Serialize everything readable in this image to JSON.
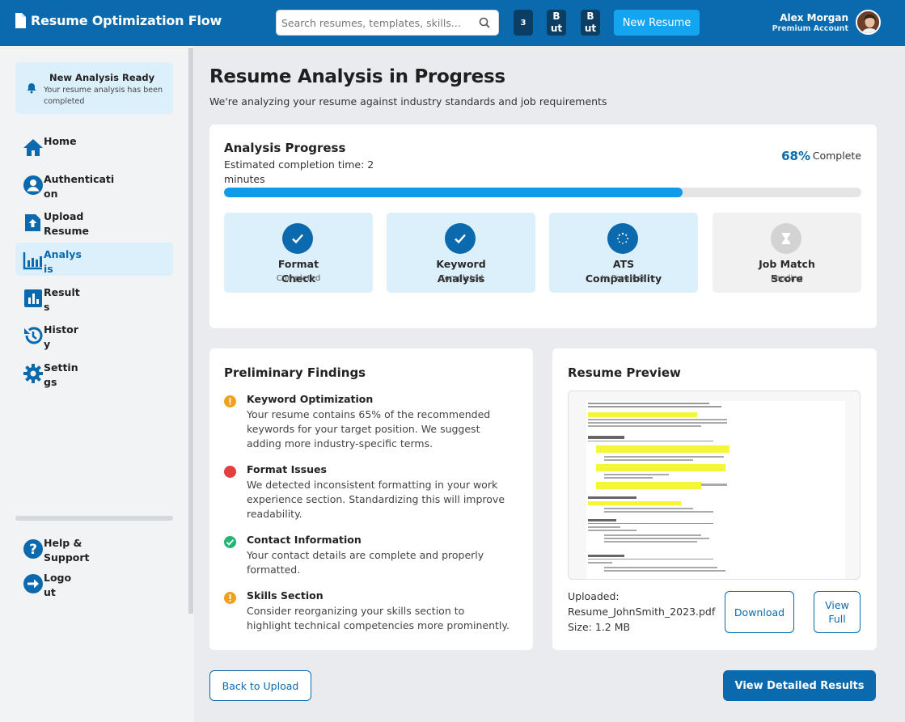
{
  "header": {
    "title": "Resume Optimization Flow",
    "search_placeholder": "Search resumes, templates, skills...",
    "badge_count": "3",
    "button_2": "B\nut",
    "button_3": "B\nut",
    "new_resume_label": "New Resume",
    "user_name": "Alex Morgan",
    "user_plan": "Premium Account",
    "accent_color": "#0a6aad"
  },
  "sidebar": {
    "notice": {
      "title": "New Analysis Ready",
      "text": "Your resume analysis has been completed"
    },
    "items": [
      {
        "label": "Home",
        "icon": "home-icon"
      },
      {
        "label": "Authentication",
        "icon": "user-icon"
      },
      {
        "label": "Upload Resume",
        "icon": "upload-icon"
      },
      {
        "label": "Analysis",
        "icon": "analysis-icon",
        "active": true
      },
      {
        "label": "Results",
        "icon": "results-icon"
      },
      {
        "label": "History",
        "icon": "history-icon"
      },
      {
        "label": "Settings",
        "icon": "gear-icon"
      }
    ],
    "bottom_items": [
      {
        "label": "Help & Support",
        "icon": "help-icon"
      },
      {
        "label": "Logout",
        "icon": "logout-icon"
      }
    ]
  },
  "main": {
    "title": "Resume Analysis in Progress",
    "subtitle": "We're analyzing your resume against industry standards and job requirements",
    "progress": {
      "title": "Analysis Progress",
      "estimate": "Estimated completion time: 2 minutes",
      "percent_label": "68%",
      "complete_label": "Complete",
      "fraction": 0.72,
      "steps": [
        {
          "name": "Format Check",
          "status": "Completed",
          "state": "done"
        },
        {
          "name": "Keyword Analysis",
          "status": "Completed",
          "state": "done"
        },
        {
          "name": "ATS Compatibility",
          "status": "In Progress",
          "state": "progress"
        },
        {
          "name": "Job Match Score",
          "status": "Pending",
          "state": "pending"
        }
      ]
    },
    "findings": {
      "title": "Preliminary Findings",
      "items": [
        {
          "title": "Keyword Optimization",
          "text": "Your resume contains 65% of the recommended keywords for your target position. We suggest adding more industry-specific terms.",
          "level": "warning",
          "color": "#f0a11b"
        },
        {
          "title": "Format Issues",
          "text": "We detected inconsistent formatting in your work experience section. Standardizing this will improve readability.",
          "level": "error",
          "color": "#e53e3e"
        },
        {
          "title": "Contact Information",
          "text": "Your contact details are complete and properly formatted.",
          "level": "success",
          "color": "#22b573"
        },
        {
          "title": "Skills Section",
          "text": "Consider reorganizing your skills section to highlight technical competencies more prominently.",
          "level": "warning",
          "color": "#f0a11b"
        }
      ]
    },
    "preview": {
      "title": "Resume Preview",
      "uploaded_label": "Uploaded:",
      "file_name": "Resume_JohnSmith_2023.pdf",
      "size": "Size: 1.2 MB",
      "download_label": "Download",
      "view_full_label": "View Full"
    },
    "back_label": "Back to Upload",
    "detailed_label": "View Detailed Results"
  }
}
